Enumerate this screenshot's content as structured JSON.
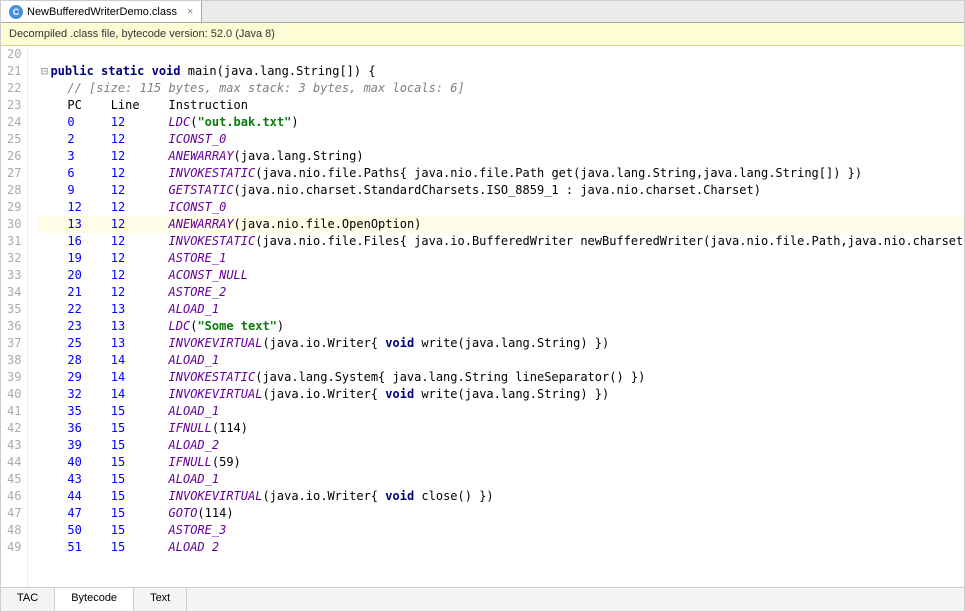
{
  "top_tab": {
    "label": "NewBufferedWriterDemo.class"
  },
  "banner": "Decompiled .class file, bytecode version: 52.0 (Java 8)",
  "gutter_start": 20,
  "highlight_gutter": 30,
  "sig": {
    "kw1": "public static void",
    "name": "main",
    "params": "java.lang.String[]"
  },
  "comment": "// [size: 115 bytes, max stack: 3 bytes, max locals: 6]",
  "headers": {
    "pc": "PC",
    "line": "Line",
    "inst": "Instruction"
  },
  "rows": [
    {
      "pc": "0",
      "line": "12",
      "inst": "LDC",
      "tail": "(\"out.bak.txt\")",
      "type": "str"
    },
    {
      "pc": "2",
      "line": "12",
      "inst": "ICONST_0",
      "tail": "",
      "type": ""
    },
    {
      "pc": "3",
      "line": "12",
      "inst": "ANEWARRAY",
      "tail": "(java.lang.String)",
      "type": "plain"
    },
    {
      "pc": "6",
      "line": "12",
      "inst": "INVOKESTATIC",
      "tail": "(java.nio.file.Paths{ java.nio.file.Path get(java.lang.String,java.lang.String[]) })",
      "type": "mixed-get"
    },
    {
      "pc": "9",
      "line": "12",
      "inst": "GETSTATIC",
      "tail": "(java.nio.charset.StandardCharsets.ISO_8859_1 : java.nio.charset.Charset)",
      "type": "plain"
    },
    {
      "pc": "12",
      "line": "12",
      "inst": "ICONST_0",
      "tail": "",
      "type": ""
    },
    {
      "pc": "13",
      "line": "12",
      "inst": "ANEWARRAY",
      "tail": "(java.nio.file.OpenOption)",
      "type": "plain",
      "hl": true
    },
    {
      "pc": "16",
      "line": "12",
      "inst": "INVOKESTATIC",
      "tail": "(java.nio.file.Files{ java.io.BufferedWriter newBufferedWriter(java.nio.file.Path,java.nio.charset",
      "type": "mixed-new"
    },
    {
      "pc": "19",
      "line": "12",
      "inst": "ASTORE_1",
      "tail": "",
      "type": ""
    },
    {
      "pc": "20",
      "line": "12",
      "inst": "ACONST_NULL",
      "tail": "",
      "type": ""
    },
    {
      "pc": "21",
      "line": "12",
      "inst": "ASTORE_2",
      "tail": "",
      "type": ""
    },
    {
      "pc": "22",
      "line": "13",
      "inst": "ALOAD_1",
      "tail": "",
      "type": ""
    },
    {
      "pc": "23",
      "line": "13",
      "inst": "LDC",
      "tail": "(\"Some text\")",
      "type": "str"
    },
    {
      "pc": "25",
      "line": "13",
      "inst": "INVOKEVIRTUAL",
      "tail": "(java.io.Writer{ void write(java.lang.String) })",
      "type": "mixed-write"
    },
    {
      "pc": "28",
      "line": "14",
      "inst": "ALOAD_1",
      "tail": "",
      "type": ""
    },
    {
      "pc": "29",
      "line": "14",
      "inst": "INVOKESTATIC",
      "tail": "(java.lang.System{ java.lang.String lineSeparator() })",
      "type": "mixed-sep"
    },
    {
      "pc": "32",
      "line": "14",
      "inst": "INVOKEVIRTUAL",
      "tail": "(java.io.Writer{ void write(java.lang.String) })",
      "type": "mixed-write"
    },
    {
      "pc": "35",
      "line": "15",
      "inst": "ALOAD_1",
      "tail": "",
      "type": ""
    },
    {
      "pc": "36",
      "line": "15",
      "inst": "IFNULL",
      "tail": "(114)",
      "type": "plain"
    },
    {
      "pc": "39",
      "line": "15",
      "inst": "ALOAD_2",
      "tail": "",
      "type": ""
    },
    {
      "pc": "40",
      "line": "15",
      "inst": "IFNULL",
      "tail": "(59)",
      "type": "plain"
    },
    {
      "pc": "43",
      "line": "15",
      "inst": "ALOAD_1",
      "tail": "",
      "type": ""
    },
    {
      "pc": "44",
      "line": "15",
      "inst": "INVOKEVIRTUAL",
      "tail": "(java.io.Writer{ void close() })",
      "type": "mixed-close"
    },
    {
      "pc": "47",
      "line": "15",
      "inst": "GOTO",
      "tail": "(114)",
      "type": "plain"
    },
    {
      "pc": "50",
      "line": "15",
      "inst": "ASTORE_3",
      "tail": "",
      "type": ""
    },
    {
      "pc": "51",
      "line": "15",
      "inst": "ALOAD 2",
      "tail": "",
      "type": ""
    }
  ],
  "bottom_tabs": {
    "tac": "TAC",
    "bytecode": "Bytecode",
    "text": "Text"
  }
}
